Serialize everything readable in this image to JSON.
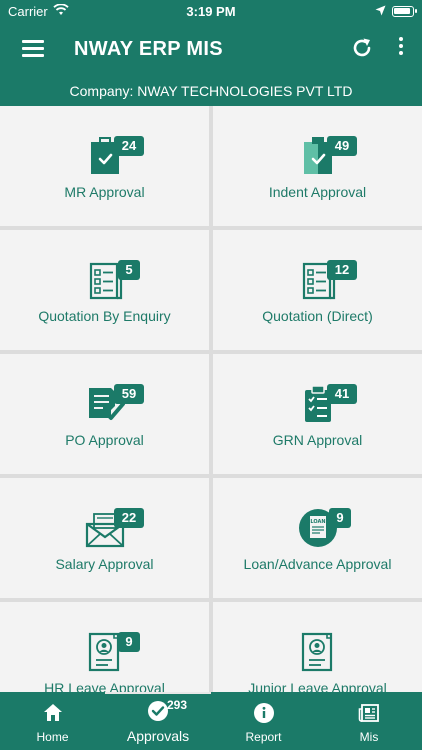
{
  "status": {
    "carrier": "Carrier",
    "time": "3:19 PM"
  },
  "app": {
    "title": "NWAY ERP MIS",
    "company": "Company: NWAY TECHNOLOGIES PVT LTD"
  },
  "tiles": [
    {
      "label": "MR Approval",
      "count": "24",
      "icon": "clipboard-check-icon"
    },
    {
      "label": "Indent Approval",
      "count": "49",
      "icon": "clipboard-check-split-icon"
    },
    {
      "label": "Quotation By Enquiry",
      "count": "5",
      "icon": "checklist-form-icon"
    },
    {
      "label": "Quotation (Direct)",
      "count": "12",
      "icon": "checklist-form-icon"
    },
    {
      "label": "PO Approval",
      "count": "59",
      "icon": "document-check-icon"
    },
    {
      "label": "GRN Approval",
      "count": "41",
      "icon": "clipboard-list-check-icon"
    },
    {
      "label": "Salary Approval",
      "count": "22",
      "icon": "envelope-money-icon"
    },
    {
      "label": "Loan/Advance Approval",
      "count": "9",
      "icon": "loan-document-icon"
    },
    {
      "label": "HR Leave Approval",
      "count": "9",
      "icon": "profile-document-icon"
    },
    {
      "label": "Junior Leave Approval",
      "count": "",
      "icon": "profile-document-icon"
    }
  ],
  "nav": {
    "home": "Home",
    "approvals": "Approvals",
    "approvals_badge": "293",
    "report": "Report",
    "mis": "Mis"
  },
  "colors": {
    "primary": "#1b7a68",
    "tile_bg": "#f3f3f3",
    "grid_line": "#dcdcdc"
  }
}
